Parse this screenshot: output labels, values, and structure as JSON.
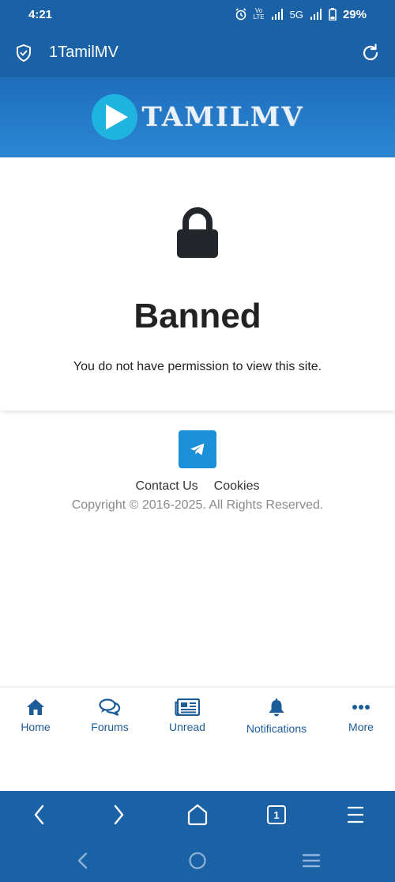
{
  "status_bar": {
    "time": "4:21",
    "network": "5G",
    "battery": "29%"
  },
  "browser": {
    "title": "1TamilMV"
  },
  "site": {
    "logo_text": "TAMILMV"
  },
  "banned": {
    "heading": "Banned",
    "message": "You do not have permission to view this site."
  },
  "footer": {
    "contact_label": "Contact Us",
    "cookies_label": "Cookies",
    "copyright": "Copyright © 2016-2025. All Rights Reserved."
  },
  "bottom_nav": {
    "items": [
      {
        "label": "Home",
        "icon": "home-icon"
      },
      {
        "label": "Forums",
        "icon": "forums-icon"
      },
      {
        "label": "Unread",
        "icon": "newspaper-icon"
      },
      {
        "label": "Notifications",
        "icon": "bell-icon"
      },
      {
        "label": "More",
        "icon": "more-icon"
      }
    ]
  },
  "browser_nav": {
    "tab_count": "1"
  },
  "colors": {
    "brand_blue": "#1a61a6",
    "nav_text": "#1c5c99",
    "telegram": "#1b8fd8"
  }
}
